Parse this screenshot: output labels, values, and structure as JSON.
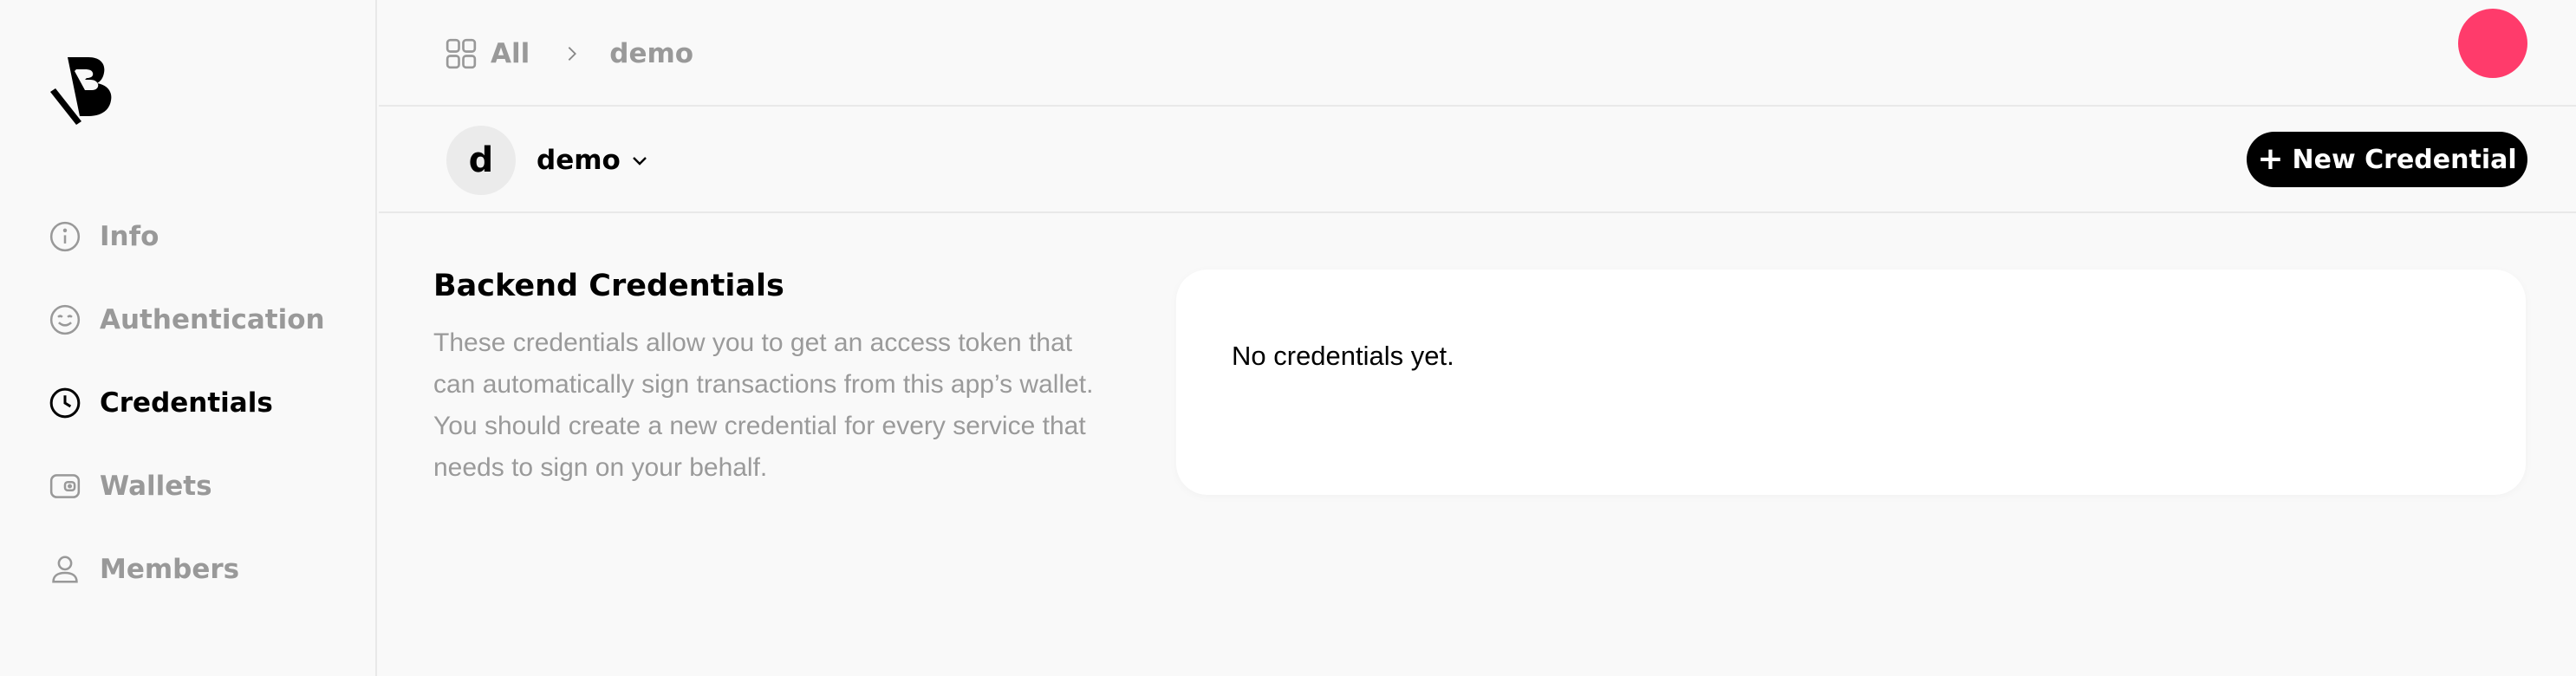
{
  "sidebar": {
    "logo_icon": "brand-logo-icon",
    "items": [
      {
        "label": "Info",
        "icon": "info-icon",
        "active": false
      },
      {
        "label": "Authentication",
        "icon": "smiley-icon",
        "active": false
      },
      {
        "label": "Credentials",
        "icon": "clock-icon",
        "active": true
      },
      {
        "label": "Wallets",
        "icon": "wallet-icon",
        "active": false
      },
      {
        "label": "Members",
        "icon": "user-icon",
        "active": false
      }
    ]
  },
  "header": {
    "breadcrumb": {
      "all_label": "All",
      "all_icon": "grid-icon",
      "separator_icon": "chevron-right-icon",
      "current": "demo"
    },
    "avatar_color": "#ff3b6b"
  },
  "subheader": {
    "app_initial": "d",
    "app_name": "demo",
    "caret_icon": "chevron-down-icon",
    "new_button_label": "New Credential",
    "new_button_icon": "plus-icon"
  },
  "main": {
    "section_title": "Backend Credentials",
    "section_description": "These credentials allow you to get an access token that can automatically sign transactions from this app’s wallet. You should create a new credential for every service that needs to sign on your behalf.",
    "empty_message": "No credentials yet."
  },
  "colors": {
    "background": "#f9f9f9",
    "muted_text": "#999999",
    "primary": "#000000",
    "accent": "#ff3b6b"
  }
}
